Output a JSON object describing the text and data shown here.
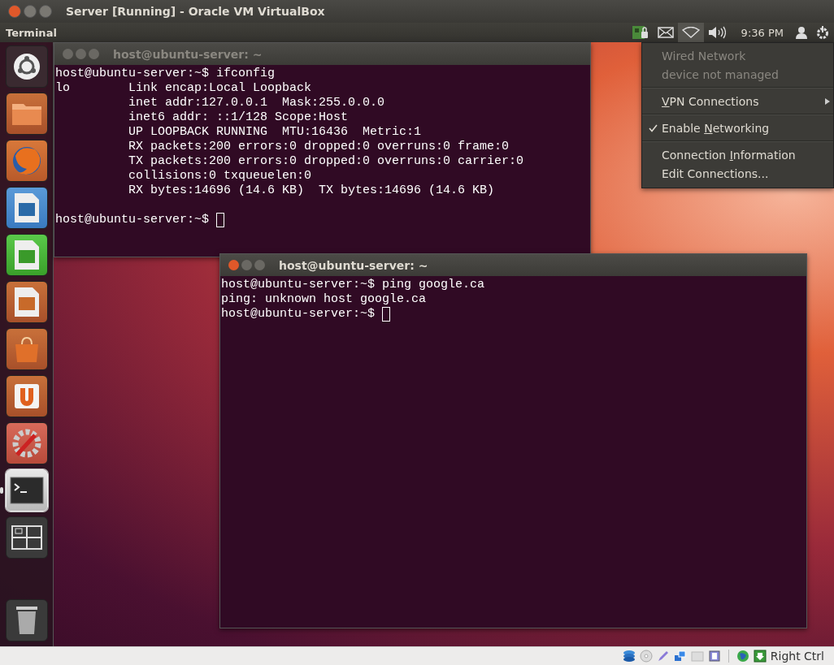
{
  "window": {
    "title": "Server [Running] - Oracle VM VirtualBox"
  },
  "top_panel": {
    "app_name": "Terminal",
    "indicators": [
      {
        "kind": "network-card",
        "selected": false
      },
      {
        "kind": "mail",
        "selected": false
      },
      {
        "kind": "wifi",
        "selected": true
      },
      {
        "kind": "sound",
        "selected": false
      }
    ],
    "time": "9:36 PM",
    "end_indicators": [
      {
        "kind": "user"
      },
      {
        "kind": "power"
      }
    ]
  },
  "launcher": {
    "items": [
      {
        "kind": "dash",
        "running": false
      },
      {
        "kind": "files",
        "running": false
      },
      {
        "kind": "browser",
        "running": false
      },
      {
        "kind": "writer",
        "running": false
      },
      {
        "kind": "calc",
        "running": false
      },
      {
        "kind": "impress",
        "running": false
      },
      {
        "kind": "store",
        "running": false
      },
      {
        "kind": "updates",
        "running": false
      },
      {
        "kind": "settings",
        "running": false
      },
      {
        "kind": "terminal",
        "running": true
      },
      {
        "kind": "workspaces",
        "running": false
      }
    ],
    "bottom_items": [
      {
        "kind": "trash",
        "running": false
      }
    ]
  },
  "terminals": [
    {
      "title": "host@ubuntu-server: ~",
      "active": false,
      "cursor": true,
      "lines": [
        {
          "kind": "text",
          "text": "host@ubuntu-server:~$ ifconfig"
        },
        {
          "kind": "text",
          "text": "lo        Link encap:Local Loopback"
        },
        {
          "kind": "text",
          "text": "          inet addr:127.0.0.1  Mask:255.0.0.0"
        },
        {
          "kind": "text",
          "text": "          inet6 addr: ::1/128 Scope:Host"
        },
        {
          "kind": "text",
          "text": "          UP LOOPBACK RUNNING  MTU:16436  Metric:1"
        },
        {
          "kind": "text",
          "text": "          RX packets:200 errors:0 dropped:0 overruns:0 frame:0"
        },
        {
          "kind": "text",
          "text": "          TX packets:200 errors:0 dropped:0 overruns:0 carrier:0"
        },
        {
          "kind": "text",
          "text": "          collisions:0 txqueuelen:0"
        },
        {
          "kind": "text",
          "text": "          RX bytes:14696 (14.6 KB)  TX bytes:14696 (14.6 KB)"
        },
        {
          "kind": "blank"
        },
        {
          "kind": "text",
          "text": "host@ubuntu-server:~$ "
        }
      ]
    },
    {
      "title": "host@ubuntu-server: ~",
      "active": true,
      "cursor": true,
      "lines": [
        {
          "kind": "text",
          "text": "host@ubuntu-server:~$ ping google.ca"
        },
        {
          "kind": "text",
          "text": "ping: unknown host google.ca"
        },
        {
          "kind": "text",
          "text": "host@ubuntu-server:~$ "
        }
      ]
    }
  ],
  "network_menu": {
    "sections": [
      [
        {
          "kind": "info",
          "before": "Wired Network"
        },
        {
          "kind": "info",
          "before": "device not managed"
        }
      ],
      [
        {
          "kind": "submenu",
          "key": "V",
          "after": "PN Connections"
        }
      ],
      [
        {
          "kind": "check",
          "checked": true,
          "before": "Enable ",
          "key": "N",
          "after": "etworking"
        }
      ],
      [
        {
          "kind": "plain",
          "before": "Connection ",
          "key": "I",
          "after": "nformation"
        },
        {
          "kind": "plain",
          "before": "Edit Connections..."
        }
      ]
    ]
  },
  "status_bar": {
    "icons": [
      {
        "kind": "disk"
      },
      {
        "kind": "optical"
      },
      {
        "kind": "usb"
      },
      {
        "kind": "network"
      },
      {
        "kind": "shared-folder"
      },
      {
        "kind": "capture"
      },
      {
        "kind": "separator"
      },
      {
        "kind": "vrde"
      },
      {
        "kind": "host-key"
      }
    ],
    "host_key": "Right Ctrl"
  }
}
